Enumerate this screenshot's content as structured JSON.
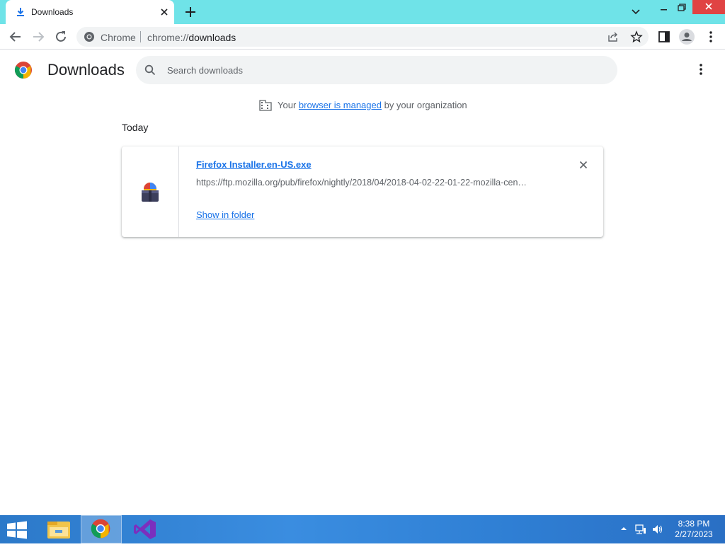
{
  "tab": {
    "title": "Downloads"
  },
  "omnibox": {
    "site_label": "Chrome",
    "url_scheme": "chrome://",
    "url_host": "downloads"
  },
  "page": {
    "title": "Downloads"
  },
  "search": {
    "placeholder": "Search downloads"
  },
  "managed": {
    "prefix": "Your",
    "link": "browser is managed",
    "suffix": "by your organization"
  },
  "list": {
    "date_label": "Today",
    "items": [
      {
        "file_name": "Firefox Installer.en-US.exe",
        "url": "https://ftp.mozilla.org/pub/firefox/nightly/2018/04/2018-04-02-22-01-22-mozilla-cen…",
        "action_label": "Show in folder"
      }
    ]
  },
  "taskbar": {
    "apps": [
      "file-explorer-icon",
      "chrome-icon",
      "visual-studio-icon"
    ],
    "clock_time": "8:38 PM",
    "clock_date": "2/27/2023"
  },
  "colors": {
    "accent": "#1a73e8",
    "tabstrip": "#6fe3e8",
    "close": "#e04343"
  }
}
